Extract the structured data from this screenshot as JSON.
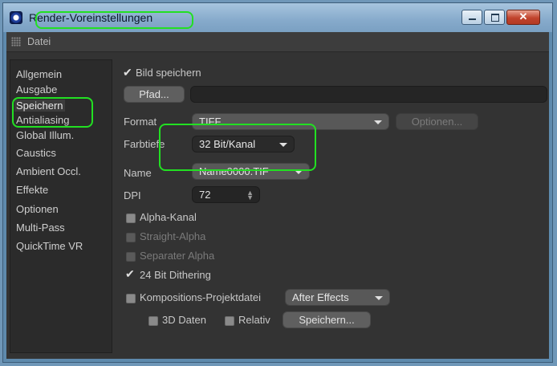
{
  "window": {
    "title": "Render-Voreinstellungen"
  },
  "menubar": {
    "file_label": "Datei"
  },
  "sidebar": {
    "items": [
      {
        "label": "Allgemein"
      },
      {
        "label": "Ausgabe"
      },
      {
        "label": "Speichern",
        "active": true
      },
      {
        "label": "Antialiasing"
      },
      {
        "label": "Global Illum."
      },
      {
        "label": "Caustics"
      },
      {
        "label": "Ambient Occl."
      },
      {
        "label": "Effekte"
      },
      {
        "label": "Optionen"
      },
      {
        "label": "Multi-Pass"
      },
      {
        "label": "QuickTime VR"
      }
    ]
  },
  "save": {
    "save_image_label": "Bild speichern",
    "save_image_checked": true,
    "path_button": "Pfad...",
    "path_value": "",
    "format_label": "Format",
    "format_value": "TIFF",
    "options_button": "Optionen...",
    "depth_label": "Farbtiefe",
    "depth_value": "32 Bit/Kanal",
    "name_label": "Name",
    "name_value": "Name0000.TIF",
    "dpi_label": "DPI",
    "dpi_value": "72",
    "alpha_label": "Alpha-Kanal",
    "straight_alpha_label": "Straight-Alpha",
    "separate_alpha_label": "Separater Alpha",
    "dithering_label": "24 Bit Dithering",
    "dithering_checked": true,
    "composition_label": "Kompositions-Projektdatei",
    "composition_app_value": "After Effects",
    "data3d_label": "3D Daten",
    "relative_label": "Relativ",
    "save_button": "Speichern..."
  },
  "colors": {
    "highlight": "#22e022",
    "panel_bg": "#333333",
    "window_frame": "#5e8aad"
  }
}
